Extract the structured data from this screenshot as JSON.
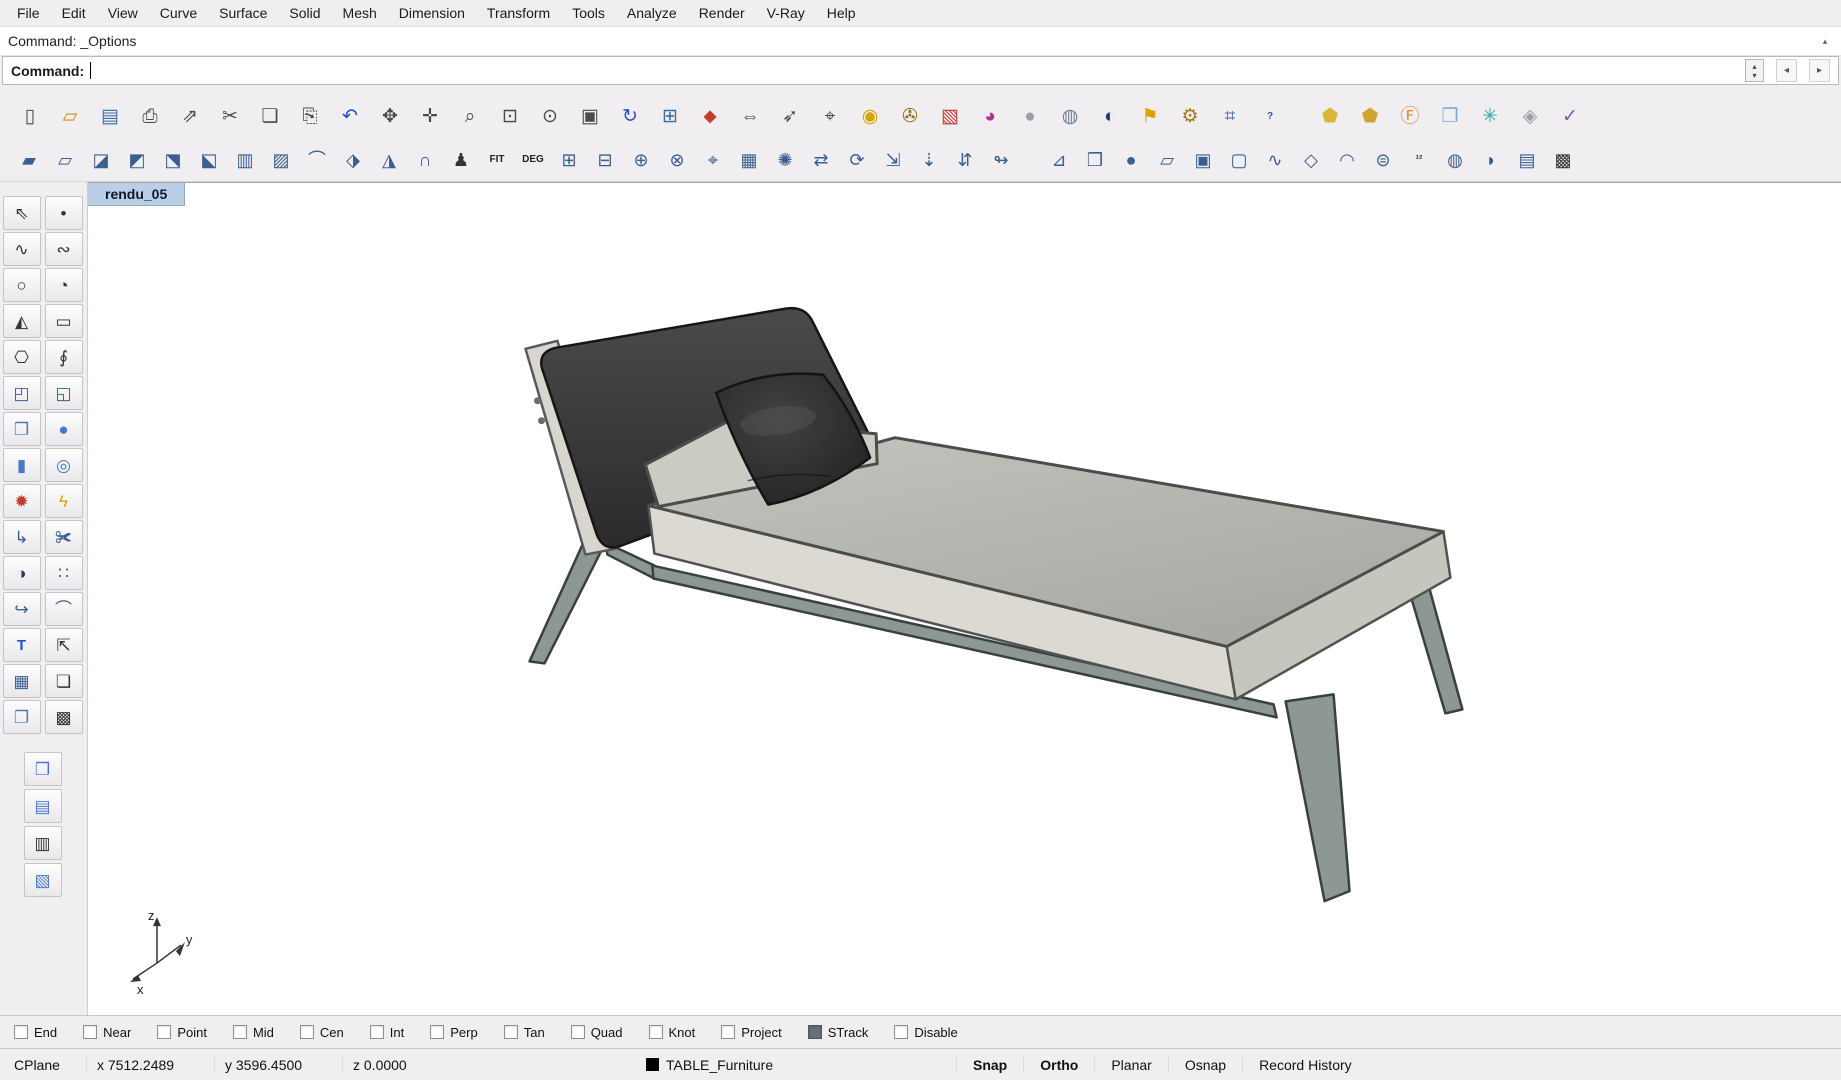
{
  "colors": {
    "chrome_bg": "#f0eef1",
    "viewport_bg": "#ffffff",
    "tab_bg": "#b9cfe8",
    "accent_blue": "#3b5f8f"
  },
  "menu": {
    "items": [
      {
        "name": "menu-file",
        "label": "File"
      },
      {
        "name": "menu-edit",
        "label": "Edit"
      },
      {
        "name": "menu-view",
        "label": "View"
      },
      {
        "name": "menu-curve",
        "label": "Curve"
      },
      {
        "name": "menu-surface",
        "label": "Surface"
      },
      {
        "name": "menu-solid",
        "label": "Solid"
      },
      {
        "name": "menu-mesh",
        "label": "Mesh"
      },
      {
        "name": "menu-dimension",
        "label": "Dimension"
      },
      {
        "name": "menu-transform",
        "label": "Transform"
      },
      {
        "name": "menu-tools",
        "label": "Tools"
      },
      {
        "name": "menu-analyze",
        "label": "Analyze"
      },
      {
        "name": "menu-render",
        "label": "Render"
      },
      {
        "name": "menu-vray",
        "label": "V-Ray"
      },
      {
        "name": "menu-help",
        "label": "Help"
      }
    ]
  },
  "command": {
    "history": "Command: _Options",
    "prompt": "Command:",
    "input_value": "",
    "scroll_up_glyph": "▴",
    "spinner_up": "▴",
    "spinner_down": "▾",
    "nav_left": "◂",
    "nav_right": "▸"
  },
  "toolbar_row1a": [
    {
      "name": "new-file-icon",
      "glyph": "▯",
      "color": "#4a4a4a"
    },
    {
      "name": "open-file-icon",
      "glyph": "▱",
      "color": "#c9921e"
    },
    {
      "name": "save-icon",
      "glyph": "▤",
      "color": "#3a6ea5"
    },
    {
      "name": "print-icon",
      "glyph": "⎙",
      "color": "#4a4a4a"
    },
    {
      "name": "export-icon",
      "glyph": "⇗",
      "color": "#4a4a4a"
    },
    {
      "name": "cut-icon",
      "glyph": "✂",
      "color": "#4a4a4a"
    },
    {
      "name": "copy-icon",
      "glyph": "❏",
      "color": "#4a4a4a"
    },
    {
      "name": "paste-icon",
      "glyph": "⎘",
      "color": "#4a4a4a"
    },
    {
      "name": "undo-icon",
      "glyph": "↶",
      "color": "#2a52be"
    },
    {
      "name": "pan-hand-icon",
      "glyph": "✥",
      "color": "#4a4a4a"
    },
    {
      "name": "move-icon",
      "glyph": "✛",
      "color": "#4a4a4a"
    },
    {
      "name": "zoom-icon",
      "glyph": "⌕",
      "color": "#4a4a4a"
    },
    {
      "name": "zoom-window-icon",
      "glyph": "⊡",
      "color": "#4a4a4a"
    },
    {
      "name": "zoom-selected-icon",
      "glyph": "⊙",
      "color": "#4a4a4a"
    },
    {
      "name": "zoom-extents-icon",
      "glyph": "▣",
      "color": "#4a4a4a"
    },
    {
      "name": "undo-view-icon",
      "glyph": "↻",
      "color": "#2a52be"
    },
    {
      "name": "viewport-layout-icon",
      "glyph": "⊞",
      "color": "#3a6ea5"
    },
    {
      "name": "named-views-icon",
      "glyph": "⬥",
      "color": "#c23b2e"
    },
    {
      "name": "distance-icon",
      "glyph": "⇔",
      "color": "#4a4a4a"
    },
    {
      "name": "direction-icon",
      "glyph": "➶",
      "color": "#4a4a4a"
    },
    {
      "name": "point-coordinates-icon",
      "glyph": "⌖",
      "color": "#4a4a4a"
    },
    {
      "name": "spotlight-icon",
      "glyph": "◉",
      "color": "#d8a400"
    },
    {
      "name": "lock-icon",
      "glyph": "✇",
      "color": "#8a6d1a"
    },
    {
      "name": "material-icon",
      "glyph": "▧",
      "color": "#c23b2e"
    },
    {
      "name": "color-wheel-icon",
      "glyph": "◕",
      "color": "#b0308f"
    },
    {
      "name": "render-sphere-icon",
      "glyph": "●",
      "color": "#98a0a6"
    },
    {
      "name": "wire-sphere-icon",
      "glyph": "◍",
      "color": "#6a7f96"
    },
    {
      "name": "shaded-sphere-icon",
      "glyph": "◐",
      "color": "#1f3a6e"
    },
    {
      "name": "flag-icon",
      "glyph": "⚑",
      "color": "#d8a400"
    },
    {
      "name": "gears-icon",
      "glyph": "⚙",
      "color": "#a07818"
    },
    {
      "name": "grid-options-icon",
      "glyph": "⌗",
      "color": "#3a6ea5"
    },
    {
      "name": "help-icon",
      "glyph": "?",
      "color": "#2a52be",
      "variant": "text"
    }
  ],
  "toolbar_row1b": [
    {
      "name": "tag-yellow-icon",
      "glyph": "⬟",
      "color": "#d9b63a"
    },
    {
      "name": "tag-olive-icon",
      "glyph": "⬟",
      "color": "#cfa52e"
    },
    {
      "name": "tag-f-icon",
      "glyph": "Ⓕ",
      "color": "#d98f2e"
    },
    {
      "name": "cube-blue-icon",
      "glyph": "❒",
      "color": "#7fa8d8"
    },
    {
      "name": "snowflake-icon",
      "glyph": "✳",
      "color": "#2ea8a0"
    },
    {
      "name": "diamond-icon",
      "glyph": "◈",
      "color": "#9aa0a8"
    },
    {
      "name": "vray-check-icon",
      "glyph": "✓",
      "color": "#7a5fa0"
    }
  ],
  "toolbar_row2a": [
    {
      "name": "srf-3pt-icon",
      "glyph": "▰"
    },
    {
      "name": "srf-pts-icon",
      "glyph": "▱"
    },
    {
      "name": "loft-icon",
      "glyph": "◪"
    },
    {
      "name": "revolve-icon",
      "glyph": "◩"
    },
    {
      "name": "sweep1-icon",
      "glyph": "⬔"
    },
    {
      "name": "sweep2-icon",
      "glyph": "⬕"
    },
    {
      "name": "network-srf-icon",
      "glyph": "▥"
    },
    {
      "name": "patch-icon",
      "glyph": "▨"
    },
    {
      "name": "drape-icon",
      "glyph": "⌒"
    },
    {
      "name": "extend-srf-icon",
      "glyph": "⬗"
    },
    {
      "name": "fillet-srf-icon",
      "glyph": "◮"
    },
    {
      "name": "arch-srf-icon",
      "glyph": "∩"
    },
    {
      "name": "heightfield-icon",
      "glyph": "♟",
      "color": "#333333"
    },
    {
      "name": "fit-srf-icon",
      "glyph": "FIT",
      "variant": "text",
      "color": "#222222"
    },
    {
      "name": "change-degree-icon",
      "glyph": "DEG",
      "variant": "text",
      "color": "#222222"
    },
    {
      "name": "match-srf-icon",
      "glyph": "⊞"
    },
    {
      "name": "merge-srf-icon",
      "glyph": "⊟"
    },
    {
      "name": "symmetry-icon",
      "glyph": "⊕"
    },
    {
      "name": "unroll-icon",
      "glyph": "⊗"
    },
    {
      "name": "smash-icon",
      "glyph": "⌖"
    },
    {
      "name": "rebuild-icon",
      "glyph": "▦"
    },
    {
      "name": "refit-icon",
      "glyph": "✺"
    },
    {
      "name": "offset-srf-icon",
      "glyph": "⇄"
    },
    {
      "name": "blend-srf-icon",
      "glyph": "⟳"
    },
    {
      "name": "chamfer-srf-icon",
      "glyph": "⇲"
    },
    {
      "name": "project-icon",
      "glyph": "⇣"
    },
    {
      "name": "pull-icon",
      "glyph": "⇵"
    },
    {
      "name": "ribbon-icon",
      "glyph": "↬"
    }
  ],
  "toolbar_row2b": [
    {
      "name": "orient-3pt-icon",
      "glyph": "⊿"
    },
    {
      "name": "cage-box-icon",
      "glyph": "❒"
    },
    {
      "name": "cage-sphere-icon",
      "glyph": "●"
    },
    {
      "name": "cage-plane-icon",
      "glyph": "▱"
    },
    {
      "name": "box-edit-icon",
      "glyph": "▣"
    },
    {
      "name": "cage-edit-icon",
      "glyph": "▢"
    },
    {
      "name": "wave-edit-icon",
      "glyph": "∿"
    },
    {
      "name": "diamond-cage-icon",
      "glyph": "◇"
    },
    {
      "name": "blend-cage-icon",
      "glyph": "◠"
    },
    {
      "name": "pipe-icon",
      "glyph": "⊜"
    },
    {
      "name": "one-two-icon",
      "glyph": "¹²",
      "variant": "text",
      "color": "#333333"
    },
    {
      "name": "lamp-icon",
      "glyph": "◍"
    },
    {
      "name": "dome-icon",
      "glyph": "◗"
    },
    {
      "name": "panel-blue-icon",
      "glyph": "▤"
    },
    {
      "name": "dot-grid-icon",
      "glyph": "▩",
      "color": "#333333"
    }
  ],
  "left_toolbar": {
    "main": [
      {
        "name": "select-arrow-icon",
        "glyph": "⇖",
        "color": "#333333"
      },
      {
        "name": "point-icon",
        "glyph": "•",
        "color": "#333333"
      },
      {
        "name": "curve-icon",
        "glyph": "∿",
        "color": "#333333"
      },
      {
        "name": "curve-interp-icon",
        "glyph": "∾",
        "color": "#333333"
      },
      {
        "name": "circle-icon",
        "glyph": "○",
        "color": "#333333"
      },
      {
        "name": "circle-2pt-icon",
        "glyph": "◔",
        "color": "#333333"
      },
      {
        "name": "cone-curve-icon",
        "glyph": "◭",
        "color": "#333333"
      },
      {
        "name": "rectangle-icon",
        "glyph": "▭",
        "color": "#333333"
      },
      {
        "name": "polygon-icon",
        "glyph": "⎔",
        "color": "#333333"
      },
      {
        "name": "helix-icon",
        "glyph": "∮",
        "color": "#333333"
      },
      {
        "name": "srf-corner-icon",
        "glyph": "◰",
        "color": "#3b5f8f"
      },
      {
        "name": "srf-patch-icon",
        "glyph": "◱",
        "color": "#3b5f8f"
      },
      {
        "name": "box-icon",
        "glyph": "❒",
        "color": "#4b79c9"
      },
      {
        "name": "sphere-icon",
        "glyph": "●",
        "color": "#4b79c9"
      },
      {
        "name": "cylinder-icon",
        "glyph": "▮",
        "color": "#4b79c9"
      },
      {
        "name": "tube-icon",
        "glyph": "◎",
        "color": "#4b79c9"
      },
      {
        "name": "boolean-icon",
        "glyph": "✹",
        "color": "#c23b2e"
      },
      {
        "name": "explode-icon",
        "glyph": "ϟ",
        "color": "#d8a400"
      },
      {
        "name": "fillet-icon",
        "glyph": "↳",
        "color": "#3b5f8f"
      },
      {
        "name": "trim-icon",
        "glyph": "✀",
        "color": "#3b5f8f"
      },
      {
        "name": "boolean-diff-icon",
        "glyph": "◑",
        "color": "#2a3c55"
      },
      {
        "name": "array-icon",
        "glyph": "∷",
        "color": "#3b5f8f"
      },
      {
        "name": "blend-curve-icon",
        "glyph": "↪",
        "color": "#3b5f8f"
      },
      {
        "name": "arc-blend-icon",
        "glyph": "⌒",
        "color": "#3b5f8f"
      },
      {
        "name": "text-icon",
        "glyph": "T",
        "color": "#2a52be",
        "variant": "text"
      },
      {
        "name": "uvn-icon",
        "glyph": "⇱",
        "color": "#333333"
      },
      {
        "name": "block-icon",
        "glyph": "▦",
        "color": "#3b5f8f"
      },
      {
        "name": "copy-inplace-icon",
        "glyph": "❏",
        "color": "#333333"
      },
      {
        "name": "solid-cube-icon",
        "glyph": "❐",
        "color": "#4b79c9"
      },
      {
        "name": "hatch-grid-icon",
        "glyph": "▩",
        "color": "#333333"
      }
    ],
    "bottom": [
      {
        "name": "render-cube-icon",
        "glyph": "❒",
        "color": "#4b79c9"
      },
      {
        "name": "layers-panel-icon",
        "glyph": "▤",
        "color": "#4b79c9"
      },
      {
        "name": "properties-panel-icon",
        "glyph": "▥",
        "color": "#333333"
      },
      {
        "name": "layer-state-icon",
        "glyph": "▧",
        "color": "#4b79c9"
      }
    ]
  },
  "viewport": {
    "tab_label": "rendu_05",
    "axis": {
      "x_label": "x",
      "y_label": "y",
      "z_label": "z"
    }
  },
  "osnap": {
    "items": [
      {
        "name": "osnap-end",
        "label": "End",
        "checked": false
      },
      {
        "name": "osnap-near",
        "label": "Near",
        "checked": false
      },
      {
        "name": "osnap-point",
        "label": "Point",
        "checked": false
      },
      {
        "name": "osnap-mid",
        "label": "Mid",
        "checked": false
      },
      {
        "name": "osnap-cen",
        "label": "Cen",
        "checked": false
      },
      {
        "name": "osnap-int",
        "label": "Int",
        "checked": false
      },
      {
        "name": "osnap-perp",
        "label": "Perp",
        "checked": false
      },
      {
        "name": "osnap-tan",
        "label": "Tan",
        "checked": false
      },
      {
        "name": "osnap-quad",
        "label": "Quad",
        "checked": false
      },
      {
        "name": "osnap-knot",
        "label": "Knot",
        "checked": false
      },
      {
        "name": "osnap-project",
        "label": "Project",
        "checked": false
      },
      {
        "name": "osnap-strack",
        "label": "STrack",
        "checked": true
      },
      {
        "name": "osnap-disable",
        "label": "Disable",
        "checked": false
      }
    ]
  },
  "status": {
    "cplane": "CPlane",
    "x": "x 7512.2489",
    "y": "y 3596.4500",
    "z": "z 0.0000",
    "layer": "TABLE_Furniture",
    "toggles": [
      {
        "name": "status-snap",
        "label": "Snap",
        "bold": true
      },
      {
        "name": "status-ortho",
        "label": "Ortho",
        "bold": true
      },
      {
        "name": "status-planar",
        "label": "Planar",
        "bold": false
      },
      {
        "name": "status-osnap",
        "label": "Osnap",
        "bold": false
      },
      {
        "name": "status-record-history",
        "label": "Record History",
        "bold": false
      }
    ]
  }
}
